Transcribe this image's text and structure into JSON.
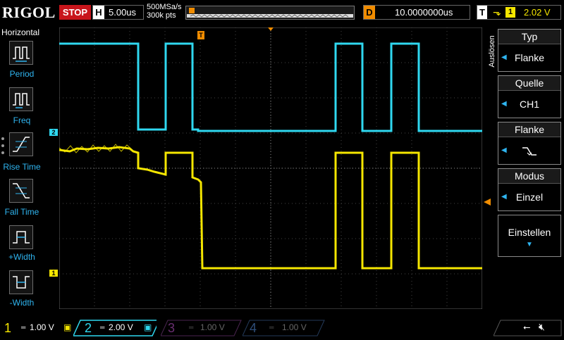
{
  "header": {
    "brand": "RIGOL",
    "run_state": "STOP",
    "horizontal": {
      "label": "H",
      "value": "5.00us"
    },
    "sample_rate": "500MSa/s",
    "memory_depth": "300k pts",
    "delay": {
      "label": "D",
      "value": "10.0000000us"
    },
    "trigger": {
      "label": "T",
      "channel": "1",
      "level": "2.02 V"
    }
  },
  "left_panel": {
    "title": "Horizontal",
    "items": [
      {
        "label": "Period",
        "icon": "period-icon"
      },
      {
        "label": "Freq",
        "icon": "frequency-icon"
      },
      {
        "label": "Rise Time",
        "icon": "rise-time-icon"
      },
      {
        "label": "Fall Time",
        "icon": "fall-time-icon"
      },
      {
        "label": "+Width",
        "icon": "positive-width-icon"
      },
      {
        "label": "-Width",
        "icon": "negative-width-icon"
      }
    ]
  },
  "right_menu": {
    "section_label": "Auslösen",
    "items": [
      {
        "title": "Typ",
        "value": "Flanke"
      },
      {
        "title": "Quelle",
        "value": "CH1"
      },
      {
        "title": "Flanke",
        "value": "",
        "icon": "falling-edge-icon"
      },
      {
        "title": "Modus",
        "value": "Einzel"
      }
    ],
    "settings_label": "Einstellen"
  },
  "markers": {
    "trigger_position": "T",
    "channel2_ground": "2",
    "channel1_ground": "1"
  },
  "channels": [
    {
      "number": "1",
      "scale": "1.00 V",
      "color": "#f5e600",
      "active": true
    },
    {
      "number": "2",
      "scale": "2.00 V",
      "color": "#2fd8f0",
      "active": true
    },
    {
      "number": "3",
      "scale": "1.00 V",
      "color": "#c23ad6",
      "active": false
    },
    {
      "number": "4",
      "scale": "1.00 V",
      "color": "#3a7fd6",
      "active": false
    }
  ],
  "colors": {
    "stop": "#c8151b",
    "channel1": "#f5e600",
    "channel2": "#2fd8f0",
    "trigger_marker": "#f08c00",
    "menu_accent": "#2fb4ef"
  },
  "status_icons": [
    "usb-icon",
    "speaker-muted-icon"
  ]
}
